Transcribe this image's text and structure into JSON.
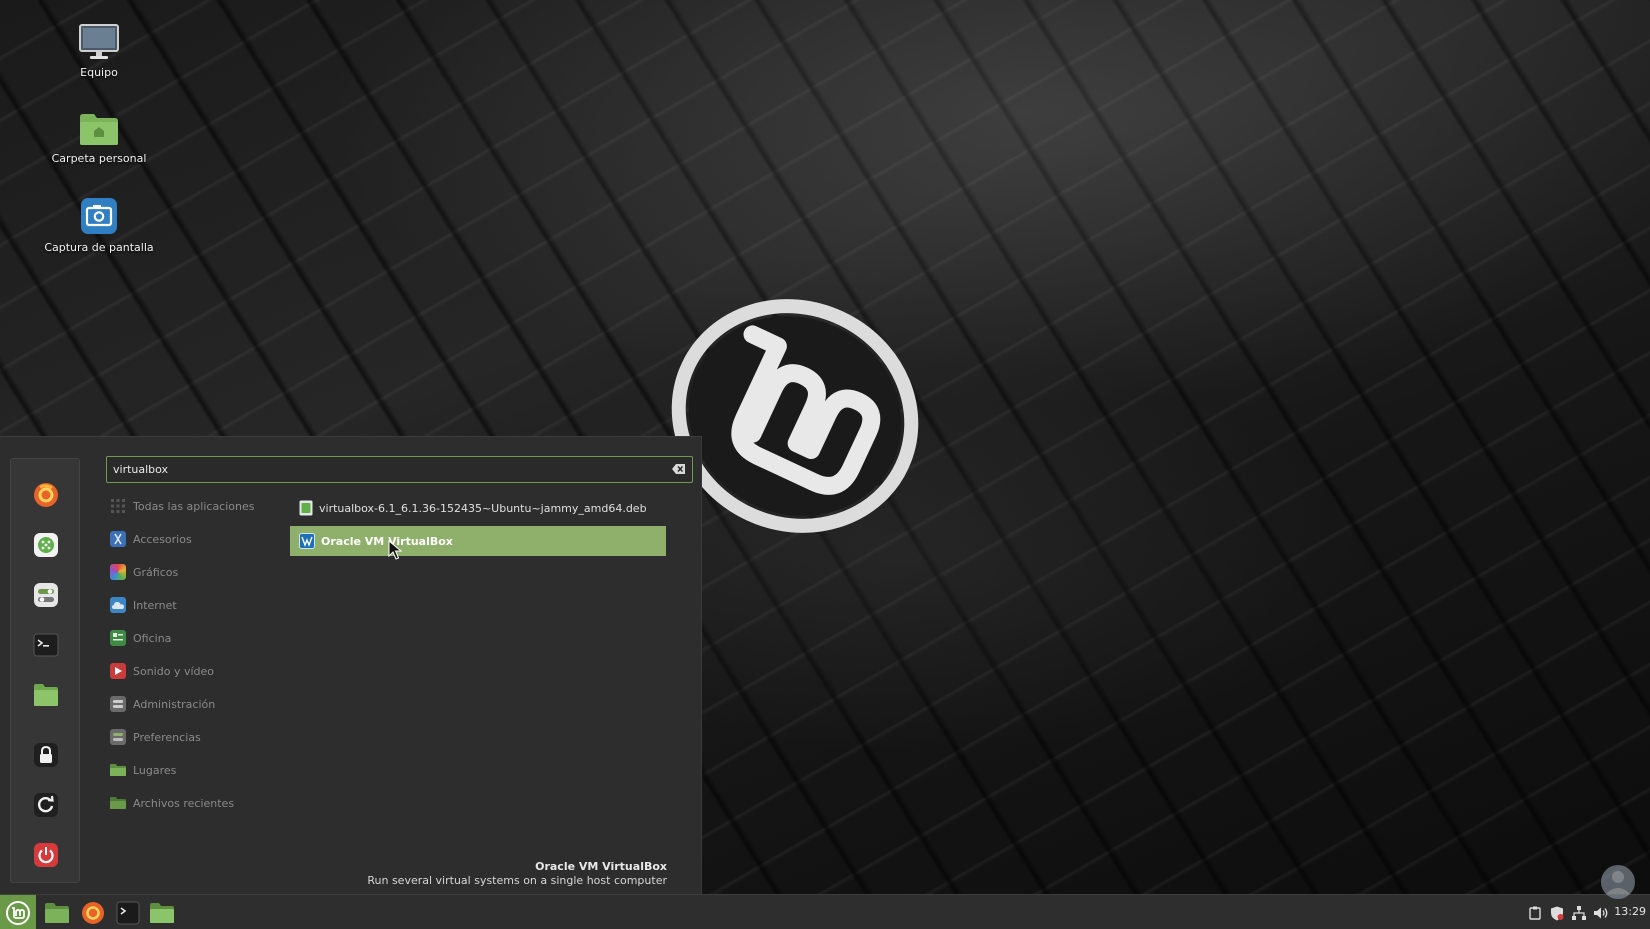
{
  "desktop": {
    "icons": [
      {
        "label": "Equipo"
      },
      {
        "label": "Carpeta personal"
      },
      {
        "label": "Captura de pantalla"
      }
    ]
  },
  "menu": {
    "search": {
      "value": "virtualbox"
    },
    "categories": [
      {
        "label": "Todas las aplicaciones"
      },
      {
        "label": "Accesorios"
      },
      {
        "label": "Gráficos"
      },
      {
        "label": "Internet"
      },
      {
        "label": "Oficina"
      },
      {
        "label": "Sonido y vídeo"
      },
      {
        "label": "Administración"
      },
      {
        "label": "Preferencias"
      },
      {
        "label": "Lugares"
      },
      {
        "label": "Archivos recientes"
      }
    ],
    "results": [
      {
        "label": "virtualbox-6.1_6.1.36-152435~Ubuntu~jammy_amd64.deb",
        "selected": false
      },
      {
        "label": "Oracle VM VirtualBox",
        "selected": true
      }
    ],
    "description": {
      "title": "Oracle VM VirtualBox",
      "text": "Run several virtual systems on a single host computer"
    },
    "favorites": [
      "firefox-icon",
      "software-manager-icon",
      "settings-icon",
      "terminal-icon",
      "files-icon",
      "lock-icon",
      "logout-icon",
      "power-icon"
    ]
  },
  "taskbar": {
    "clock": "13:29"
  },
  "colors": {
    "accent": "#8fb06b",
    "mint_green": "#6a9a48",
    "menu_bg": "#2d2d2d"
  }
}
